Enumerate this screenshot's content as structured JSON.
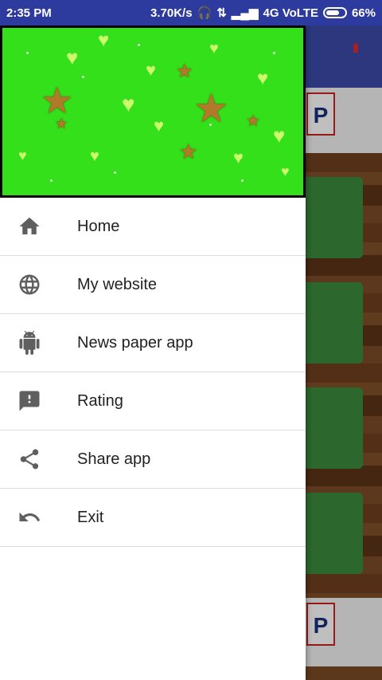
{
  "status_bar": {
    "time": "2:35 PM",
    "network_speed": "3.70K/s",
    "network_type": "4G VoLTE",
    "battery": "66%"
  },
  "drawer": {
    "header_image": "green-glitter-stars-hearts",
    "items": [
      {
        "label": "Home",
        "icon": "home-icon"
      },
      {
        "label": "My website",
        "icon": "globe-icon"
      },
      {
        "label": "News paper app",
        "icon": "android-icon"
      },
      {
        "label": "Rating",
        "icon": "feedback-icon"
      },
      {
        "label": "Share app",
        "icon": "share-icon"
      },
      {
        "label": "Exit",
        "icon": "undo-icon"
      }
    ]
  },
  "colors": {
    "status_bar": "#2d3a9e",
    "header_green": "#33e01a",
    "card_green": "#3b8a3e",
    "icon_gray": "#5f5f5f"
  }
}
